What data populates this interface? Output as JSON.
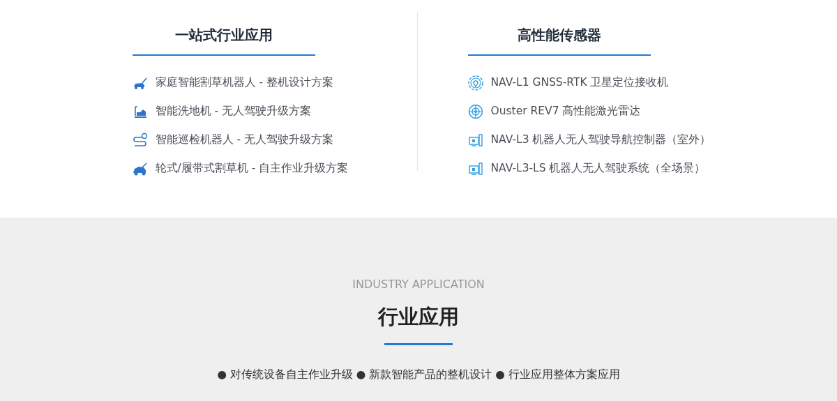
{
  "columns": [
    {
      "title": "一站式行业应用",
      "items": [
        {
          "kind": "mower",
          "text": "家庭智能割草机器人 - 整机设计方案"
        },
        {
          "kind": "scrubber",
          "text": "智能洗地机 - 无人驾驶升级方案"
        },
        {
          "kind": "route",
          "text": "智能巡检机器人 - 无人驾驶升级方案"
        },
        {
          "kind": "tractor",
          "text": "轮式/履带式割草机 - 自主作业升级方案"
        }
      ]
    },
    {
      "title": "高性能传感器",
      "items": [
        {
          "kind": "pin",
          "text": "NAV-L1 GNSS-RTK 卫星定位接收机"
        },
        {
          "kind": "target",
          "text": "Ouster REV7 高性能激光雷达"
        },
        {
          "kind": "computer",
          "text": "NAV-L3 机器人无人驾驶导航控制器（室外）"
        },
        {
          "kind": "computer",
          "text": "NAV-L3-LS 机器人无人驾驶系统（全场景）"
        }
      ]
    }
  ],
  "industry": {
    "subtitle": "INDUSTRY APPLICATION",
    "title": "行业应用",
    "summary": "● 对传统设备自主作业升级 ● 新款智能产品的整机设计 ● 行业应用整体方案应用"
  }
}
